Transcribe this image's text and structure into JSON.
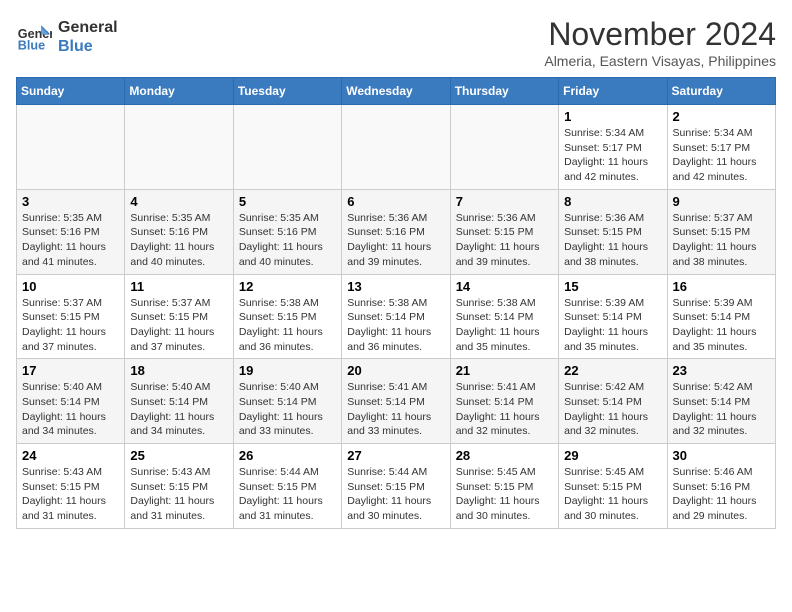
{
  "logo": {
    "line1": "General",
    "line2": "Blue"
  },
  "title": "November 2024",
  "location": "Almeria, Eastern Visayas, Philippines",
  "header": {
    "days": [
      "Sunday",
      "Monday",
      "Tuesday",
      "Wednesday",
      "Thursday",
      "Friday",
      "Saturday"
    ]
  },
  "weeks": [
    [
      {
        "day": "",
        "info": ""
      },
      {
        "day": "",
        "info": ""
      },
      {
        "day": "",
        "info": ""
      },
      {
        "day": "",
        "info": ""
      },
      {
        "day": "",
        "info": ""
      },
      {
        "day": "1",
        "info": "Sunrise: 5:34 AM\nSunset: 5:17 PM\nDaylight: 11 hours and 42 minutes."
      },
      {
        "day": "2",
        "info": "Sunrise: 5:34 AM\nSunset: 5:17 PM\nDaylight: 11 hours and 42 minutes."
      }
    ],
    [
      {
        "day": "3",
        "info": "Sunrise: 5:35 AM\nSunset: 5:16 PM\nDaylight: 11 hours and 41 minutes."
      },
      {
        "day": "4",
        "info": "Sunrise: 5:35 AM\nSunset: 5:16 PM\nDaylight: 11 hours and 40 minutes."
      },
      {
        "day": "5",
        "info": "Sunrise: 5:35 AM\nSunset: 5:16 PM\nDaylight: 11 hours and 40 minutes."
      },
      {
        "day": "6",
        "info": "Sunrise: 5:36 AM\nSunset: 5:16 PM\nDaylight: 11 hours and 39 minutes."
      },
      {
        "day": "7",
        "info": "Sunrise: 5:36 AM\nSunset: 5:15 PM\nDaylight: 11 hours and 39 minutes."
      },
      {
        "day": "8",
        "info": "Sunrise: 5:36 AM\nSunset: 5:15 PM\nDaylight: 11 hours and 38 minutes."
      },
      {
        "day": "9",
        "info": "Sunrise: 5:37 AM\nSunset: 5:15 PM\nDaylight: 11 hours and 38 minutes."
      }
    ],
    [
      {
        "day": "10",
        "info": "Sunrise: 5:37 AM\nSunset: 5:15 PM\nDaylight: 11 hours and 37 minutes."
      },
      {
        "day": "11",
        "info": "Sunrise: 5:37 AM\nSunset: 5:15 PM\nDaylight: 11 hours and 37 minutes."
      },
      {
        "day": "12",
        "info": "Sunrise: 5:38 AM\nSunset: 5:15 PM\nDaylight: 11 hours and 36 minutes."
      },
      {
        "day": "13",
        "info": "Sunrise: 5:38 AM\nSunset: 5:14 PM\nDaylight: 11 hours and 36 minutes."
      },
      {
        "day": "14",
        "info": "Sunrise: 5:38 AM\nSunset: 5:14 PM\nDaylight: 11 hours and 35 minutes."
      },
      {
        "day": "15",
        "info": "Sunrise: 5:39 AM\nSunset: 5:14 PM\nDaylight: 11 hours and 35 minutes."
      },
      {
        "day": "16",
        "info": "Sunrise: 5:39 AM\nSunset: 5:14 PM\nDaylight: 11 hours and 35 minutes."
      }
    ],
    [
      {
        "day": "17",
        "info": "Sunrise: 5:40 AM\nSunset: 5:14 PM\nDaylight: 11 hours and 34 minutes."
      },
      {
        "day": "18",
        "info": "Sunrise: 5:40 AM\nSunset: 5:14 PM\nDaylight: 11 hours and 34 minutes."
      },
      {
        "day": "19",
        "info": "Sunrise: 5:40 AM\nSunset: 5:14 PM\nDaylight: 11 hours and 33 minutes."
      },
      {
        "day": "20",
        "info": "Sunrise: 5:41 AM\nSunset: 5:14 PM\nDaylight: 11 hours and 33 minutes."
      },
      {
        "day": "21",
        "info": "Sunrise: 5:41 AM\nSunset: 5:14 PM\nDaylight: 11 hours and 32 minutes."
      },
      {
        "day": "22",
        "info": "Sunrise: 5:42 AM\nSunset: 5:14 PM\nDaylight: 11 hours and 32 minutes."
      },
      {
        "day": "23",
        "info": "Sunrise: 5:42 AM\nSunset: 5:14 PM\nDaylight: 11 hours and 32 minutes."
      }
    ],
    [
      {
        "day": "24",
        "info": "Sunrise: 5:43 AM\nSunset: 5:15 PM\nDaylight: 11 hours and 31 minutes."
      },
      {
        "day": "25",
        "info": "Sunrise: 5:43 AM\nSunset: 5:15 PM\nDaylight: 11 hours and 31 minutes."
      },
      {
        "day": "26",
        "info": "Sunrise: 5:44 AM\nSunset: 5:15 PM\nDaylight: 11 hours and 31 minutes."
      },
      {
        "day": "27",
        "info": "Sunrise: 5:44 AM\nSunset: 5:15 PM\nDaylight: 11 hours and 30 minutes."
      },
      {
        "day": "28",
        "info": "Sunrise: 5:45 AM\nSunset: 5:15 PM\nDaylight: 11 hours and 30 minutes."
      },
      {
        "day": "29",
        "info": "Sunrise: 5:45 AM\nSunset: 5:15 PM\nDaylight: 11 hours and 30 minutes."
      },
      {
        "day": "30",
        "info": "Sunrise: 5:46 AM\nSunset: 5:16 PM\nDaylight: 11 hours and 29 minutes."
      }
    ]
  ]
}
